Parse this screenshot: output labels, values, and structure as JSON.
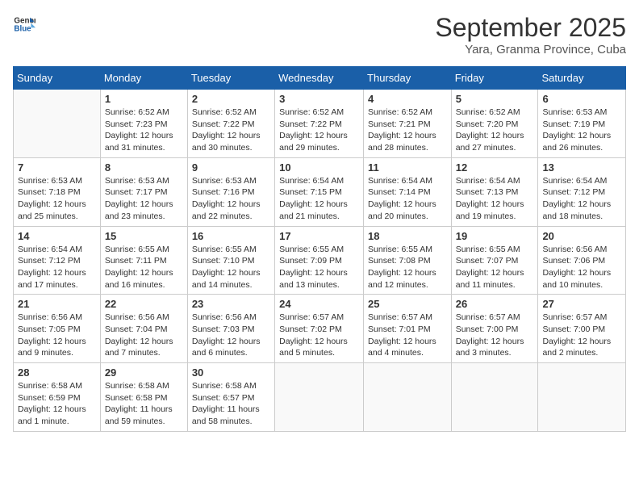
{
  "header": {
    "logo_line1": "General",
    "logo_line2": "Blue",
    "month_title": "September 2025",
    "subtitle": "Yara, Granma Province, Cuba"
  },
  "weekdays": [
    "Sunday",
    "Monday",
    "Tuesday",
    "Wednesday",
    "Thursday",
    "Friday",
    "Saturday"
  ],
  "weeks": [
    [
      {
        "day": "",
        "info": ""
      },
      {
        "day": "1",
        "info": "Sunrise: 6:52 AM\nSunset: 7:23 PM\nDaylight: 12 hours\nand 31 minutes."
      },
      {
        "day": "2",
        "info": "Sunrise: 6:52 AM\nSunset: 7:22 PM\nDaylight: 12 hours\nand 30 minutes."
      },
      {
        "day": "3",
        "info": "Sunrise: 6:52 AM\nSunset: 7:22 PM\nDaylight: 12 hours\nand 29 minutes."
      },
      {
        "day": "4",
        "info": "Sunrise: 6:52 AM\nSunset: 7:21 PM\nDaylight: 12 hours\nand 28 minutes."
      },
      {
        "day": "5",
        "info": "Sunrise: 6:52 AM\nSunset: 7:20 PM\nDaylight: 12 hours\nand 27 minutes."
      },
      {
        "day": "6",
        "info": "Sunrise: 6:53 AM\nSunset: 7:19 PM\nDaylight: 12 hours\nand 26 minutes."
      }
    ],
    [
      {
        "day": "7",
        "info": "Sunrise: 6:53 AM\nSunset: 7:18 PM\nDaylight: 12 hours\nand 25 minutes."
      },
      {
        "day": "8",
        "info": "Sunrise: 6:53 AM\nSunset: 7:17 PM\nDaylight: 12 hours\nand 23 minutes."
      },
      {
        "day": "9",
        "info": "Sunrise: 6:53 AM\nSunset: 7:16 PM\nDaylight: 12 hours\nand 22 minutes."
      },
      {
        "day": "10",
        "info": "Sunrise: 6:54 AM\nSunset: 7:15 PM\nDaylight: 12 hours\nand 21 minutes."
      },
      {
        "day": "11",
        "info": "Sunrise: 6:54 AM\nSunset: 7:14 PM\nDaylight: 12 hours\nand 20 minutes."
      },
      {
        "day": "12",
        "info": "Sunrise: 6:54 AM\nSunset: 7:13 PM\nDaylight: 12 hours\nand 19 minutes."
      },
      {
        "day": "13",
        "info": "Sunrise: 6:54 AM\nSunset: 7:12 PM\nDaylight: 12 hours\nand 18 minutes."
      }
    ],
    [
      {
        "day": "14",
        "info": "Sunrise: 6:54 AM\nSunset: 7:12 PM\nDaylight: 12 hours\nand 17 minutes."
      },
      {
        "day": "15",
        "info": "Sunrise: 6:55 AM\nSunset: 7:11 PM\nDaylight: 12 hours\nand 16 minutes."
      },
      {
        "day": "16",
        "info": "Sunrise: 6:55 AM\nSunset: 7:10 PM\nDaylight: 12 hours\nand 14 minutes."
      },
      {
        "day": "17",
        "info": "Sunrise: 6:55 AM\nSunset: 7:09 PM\nDaylight: 12 hours\nand 13 minutes."
      },
      {
        "day": "18",
        "info": "Sunrise: 6:55 AM\nSunset: 7:08 PM\nDaylight: 12 hours\nand 12 minutes."
      },
      {
        "day": "19",
        "info": "Sunrise: 6:55 AM\nSunset: 7:07 PM\nDaylight: 12 hours\nand 11 minutes."
      },
      {
        "day": "20",
        "info": "Sunrise: 6:56 AM\nSunset: 7:06 PM\nDaylight: 12 hours\nand 10 minutes."
      }
    ],
    [
      {
        "day": "21",
        "info": "Sunrise: 6:56 AM\nSunset: 7:05 PM\nDaylight: 12 hours\nand 9 minutes."
      },
      {
        "day": "22",
        "info": "Sunrise: 6:56 AM\nSunset: 7:04 PM\nDaylight: 12 hours\nand 7 minutes."
      },
      {
        "day": "23",
        "info": "Sunrise: 6:56 AM\nSunset: 7:03 PM\nDaylight: 12 hours\nand 6 minutes."
      },
      {
        "day": "24",
        "info": "Sunrise: 6:57 AM\nSunset: 7:02 PM\nDaylight: 12 hours\nand 5 minutes."
      },
      {
        "day": "25",
        "info": "Sunrise: 6:57 AM\nSunset: 7:01 PM\nDaylight: 12 hours\nand 4 minutes."
      },
      {
        "day": "26",
        "info": "Sunrise: 6:57 AM\nSunset: 7:00 PM\nDaylight: 12 hours\nand 3 minutes."
      },
      {
        "day": "27",
        "info": "Sunrise: 6:57 AM\nSunset: 7:00 PM\nDaylight: 12 hours\nand 2 minutes."
      }
    ],
    [
      {
        "day": "28",
        "info": "Sunrise: 6:58 AM\nSunset: 6:59 PM\nDaylight: 12 hours\nand 1 minute."
      },
      {
        "day": "29",
        "info": "Sunrise: 6:58 AM\nSunset: 6:58 PM\nDaylight: 11 hours\nand 59 minutes."
      },
      {
        "day": "30",
        "info": "Sunrise: 6:58 AM\nSunset: 6:57 PM\nDaylight: 11 hours\nand 58 minutes."
      },
      {
        "day": "",
        "info": ""
      },
      {
        "day": "",
        "info": ""
      },
      {
        "day": "",
        "info": ""
      },
      {
        "day": "",
        "info": ""
      }
    ]
  ]
}
